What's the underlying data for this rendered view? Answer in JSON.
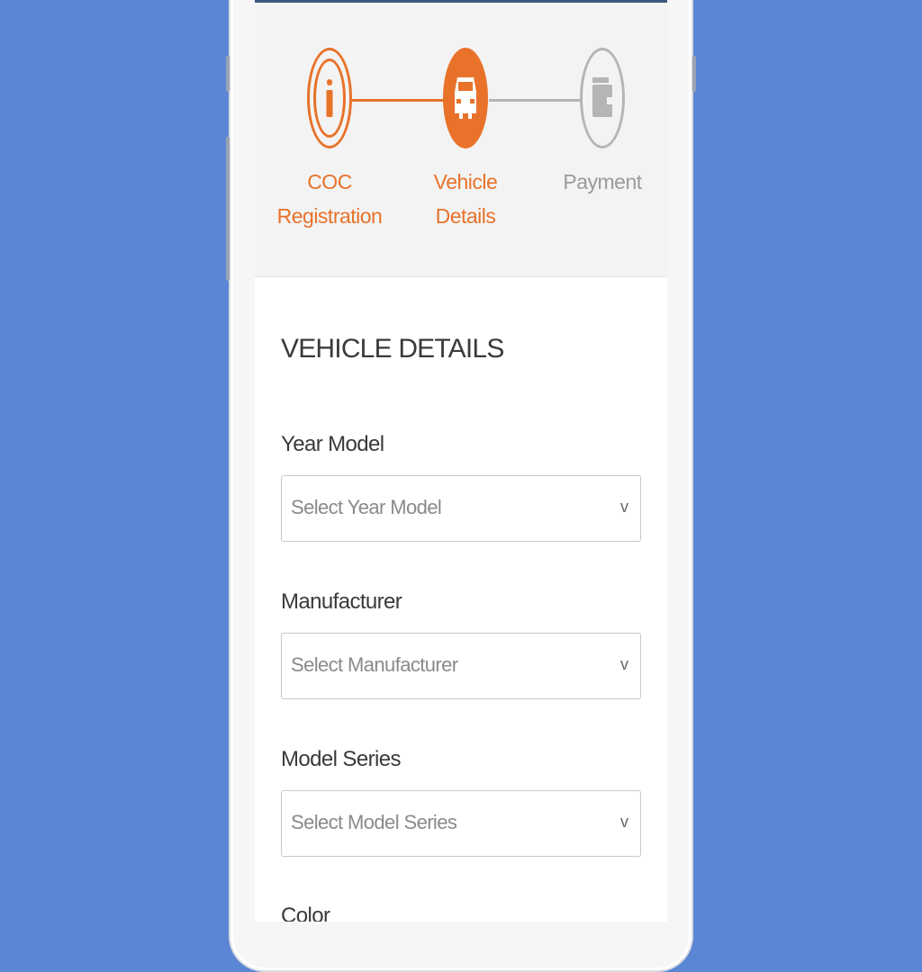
{
  "colors": {
    "background": "#5b86d3",
    "accent": "#e8722a",
    "inactive": "#b5b5b5"
  },
  "stepper": {
    "steps": [
      {
        "label_line1": "COC",
        "label_line2": "Registration",
        "icon": "info-icon",
        "state": "completed"
      },
      {
        "label_line1": "Vehicle",
        "label_line2": "Details",
        "icon": "car-icon",
        "state": "active"
      },
      {
        "label_line1": "Payment",
        "label_line2": "",
        "icon": "wallet-icon",
        "state": "pending"
      }
    ]
  },
  "form": {
    "title": "VEHICLE DETAILS",
    "fields": [
      {
        "label": "Year Model",
        "placeholder": "Select Year Model"
      },
      {
        "label": "Manufacturer",
        "placeholder": "Select Manufacturer"
      },
      {
        "label": "Model Series",
        "placeholder": "Select Model Series"
      },
      {
        "label": "Color",
        "placeholder": ""
      }
    ],
    "chevron": "v"
  }
}
